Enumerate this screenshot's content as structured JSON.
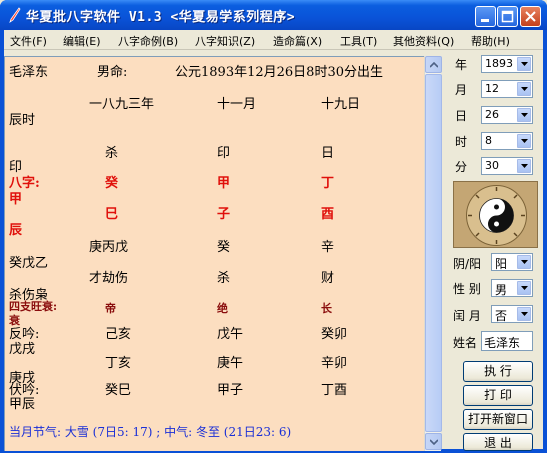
{
  "window": {
    "title": "华夏批八字软件  V1.3    <华夏易学系列程序>"
  },
  "menu": [
    {
      "label": "文件(F)"
    },
    {
      "label": "编辑(E)"
    },
    {
      "label": "八字命例(B)"
    },
    {
      "label": "八字知识(Z)"
    },
    {
      "label": "造命篇(X)"
    },
    {
      "label": "工具(T)"
    },
    {
      "label": "其他资料(Q)"
    },
    {
      "label": "帮助(H)"
    }
  ],
  "chart": {
    "name": "毛泽东",
    "gender": "男命:",
    "birth": "公元1893年12月26日8时30分出生",
    "lunar": [
      "一八九三年",
      "十一月",
      "十九日"
    ],
    "hour_branch": "辰时",
    "gods": [
      "杀",
      "印",
      "日"
    ],
    "hour_god": "印",
    "bazi_label": "八字:",
    "stems": [
      "癸",
      "甲",
      "丁"
    ],
    "hour_stem": "甲",
    "branches": [
      "巳",
      "子",
      "酉"
    ],
    "hour_branch_char": "辰",
    "hidden": [
      "庚丙戊",
      "癸",
      "辛"
    ],
    "hour_hidden": "癸戊乙",
    "hidden_gods": [
      "才劫伤",
      "杀",
      "财"
    ],
    "hour_hidden_gods": "杀伤枭",
    "season_label": "四支旺衰:",
    "season": [
      "帝",
      "绝",
      "长"
    ],
    "season_hour": "衰",
    "nayin_label": "反吟:",
    "nayin1": [
      "己亥",
      "戊午",
      "癸卯"
    ],
    "nayin1_hour": "戊戌",
    "nayin2": [
      "丁亥",
      "庚午",
      "辛卯"
    ],
    "nayin2_hour": "庚戌",
    "fuyin_label": "伏吟:",
    "nayin3": [
      "癸巳",
      "甲子",
      "丁酉"
    ],
    "nayin3_hour": "甲辰",
    "solar_terms": "当月节气: 大雪 (7日5: 17) ; 中气: 冬至 (21日23: 6)"
  },
  "controls": {
    "year_label": "年",
    "year": "1893",
    "month_label": "月",
    "month": "12",
    "day_label": "日",
    "day": "26",
    "hour_label": "时",
    "hour": "8",
    "minute_label": "分",
    "minute": "30",
    "yinyang_label": "阴/阳",
    "yinyang": "阳",
    "gender_label": "性 别",
    "gender": "男",
    "leap_label": "闰 月",
    "leap": "否",
    "name_label": "姓名",
    "name": "毛泽东",
    "run": "执  行",
    "print": "打  印",
    "new_window": "打开新窗口",
    "exit": "退  出"
  },
  "colors": {
    "panel": "#fcdec0",
    "title_blue": "#0a53d8",
    "red": "#e0100b"
  }
}
